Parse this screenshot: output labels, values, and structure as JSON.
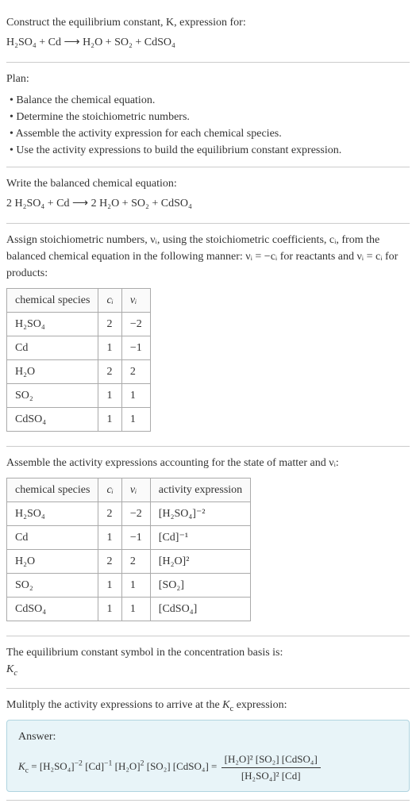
{
  "intro": {
    "prompt": "Construct the equilibrium constant, K, expression for:",
    "equation": "H₂SO₄ + Cd ⟶ H₂O + SO₂ + CdSO₄"
  },
  "plan": {
    "heading": "Plan:",
    "items": [
      "• Balance the chemical equation.",
      "• Determine the stoichiometric numbers.",
      "• Assemble the activity expression for each chemical species.",
      "• Use the activity expressions to build the equilibrium constant expression."
    ]
  },
  "balanced": {
    "heading": "Write the balanced chemical equation:",
    "equation": "2 H₂SO₄ + Cd ⟶ 2 H₂O + SO₂ + CdSO₄"
  },
  "stoich": {
    "text": "Assign stoichiometric numbers, νᵢ, using the stoichiometric coefficients, cᵢ, from the balanced chemical equation in the following manner: νᵢ = −cᵢ for reactants and νᵢ = cᵢ for products:",
    "headers": [
      "chemical species",
      "cᵢ",
      "νᵢ"
    ],
    "rows": [
      {
        "species": "H₂SO₄",
        "c": "2",
        "v": "−2"
      },
      {
        "species": "Cd",
        "c": "1",
        "v": "−1"
      },
      {
        "species": "H₂O",
        "c": "2",
        "v": "2"
      },
      {
        "species": "SO₂",
        "c": "1",
        "v": "1"
      },
      {
        "species": "CdSO₄",
        "c": "1",
        "v": "1"
      }
    ]
  },
  "activity": {
    "text": "Assemble the activity expressions accounting for the state of matter and νᵢ:",
    "headers": [
      "chemical species",
      "cᵢ",
      "νᵢ",
      "activity expression"
    ],
    "rows": [
      {
        "species": "H₂SO₄",
        "c": "2",
        "v": "−2",
        "expr": "[H₂SO₄]⁻²"
      },
      {
        "species": "Cd",
        "c": "1",
        "v": "−1",
        "expr": "[Cd]⁻¹"
      },
      {
        "species": "H₂O",
        "c": "2",
        "v": "2",
        "expr": "[H₂O]²"
      },
      {
        "species": "SO₂",
        "c": "1",
        "v": "1",
        "expr": "[SO₂]"
      },
      {
        "species": "CdSO₄",
        "c": "1",
        "v": "1",
        "expr": "[CdSO₄]"
      }
    ]
  },
  "symbol": {
    "text": "The equilibrium constant symbol in the concentration basis is:",
    "value": "K_c"
  },
  "multiply": {
    "text": "Mulitply the activity expressions to arrive at the K_c expression:"
  },
  "answer": {
    "label": "Answer:",
    "lhs": "K_c = [H₂SO₄]⁻² [Cd]⁻¹ [H₂O]² [SO₂] [CdSO₄] = ",
    "num": "[H₂O]² [SO₂] [CdSO₄]",
    "den": "[H₂SO₄]² [Cd]"
  }
}
